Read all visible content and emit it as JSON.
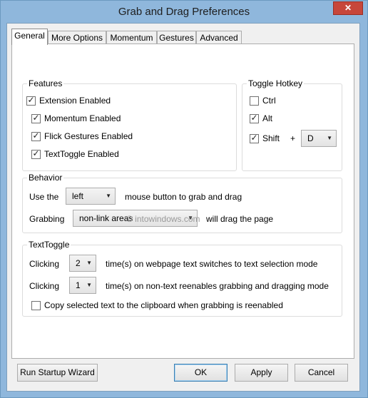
{
  "window": {
    "title": "Grab and Drag Preferences",
    "close_glyph": "✕"
  },
  "tabs": [
    {
      "label": "General"
    },
    {
      "label": "More Options"
    },
    {
      "label": "Momentum"
    },
    {
      "label": "Gestures"
    },
    {
      "label": "Advanced"
    }
  ],
  "features": {
    "title": "Features",
    "items": [
      {
        "label": "Extension Enabled",
        "checked": true
      },
      {
        "label": "Momentum Enabled",
        "checked": true
      },
      {
        "label": "Flick Gestures Enabled",
        "checked": true
      },
      {
        "label": "TextToggle Enabled",
        "checked": true
      }
    ]
  },
  "hotkey": {
    "title": "Toggle Hotkey",
    "items": [
      {
        "label": "Ctrl",
        "checked": false
      },
      {
        "label": "Alt",
        "checked": true
      },
      {
        "label": "Shift",
        "checked": true
      }
    ],
    "plus": "+",
    "key_value": "D"
  },
  "behavior": {
    "title": "Behavior",
    "use_the": "Use the",
    "button_value": "left",
    "mouse_text": "mouse button to grab and drag",
    "grabbing": "Grabbing",
    "area_value": "non-link areas",
    "drag_text": "will drag the page"
  },
  "texttoggle": {
    "title": "TextToggle",
    "clicking1": "Clicking",
    "value1": "2",
    "text1": "time(s) on webpage text switches to text selection mode",
    "clicking2": "Clicking",
    "value2": "1",
    "text2": "time(s) on non-text reenables grabbing and dragging mode",
    "copy_label": "Copy selected text to the clipboard when grabbing is reenabled",
    "copy_checked": false
  },
  "watermark": "© intowindows.com",
  "buttons": {
    "wizard": "Run Startup Wizard",
    "ok": "OK",
    "apply": "Apply",
    "cancel": "Cancel"
  },
  "check_glyph": "✓",
  "arrow_glyph": "▼"
}
